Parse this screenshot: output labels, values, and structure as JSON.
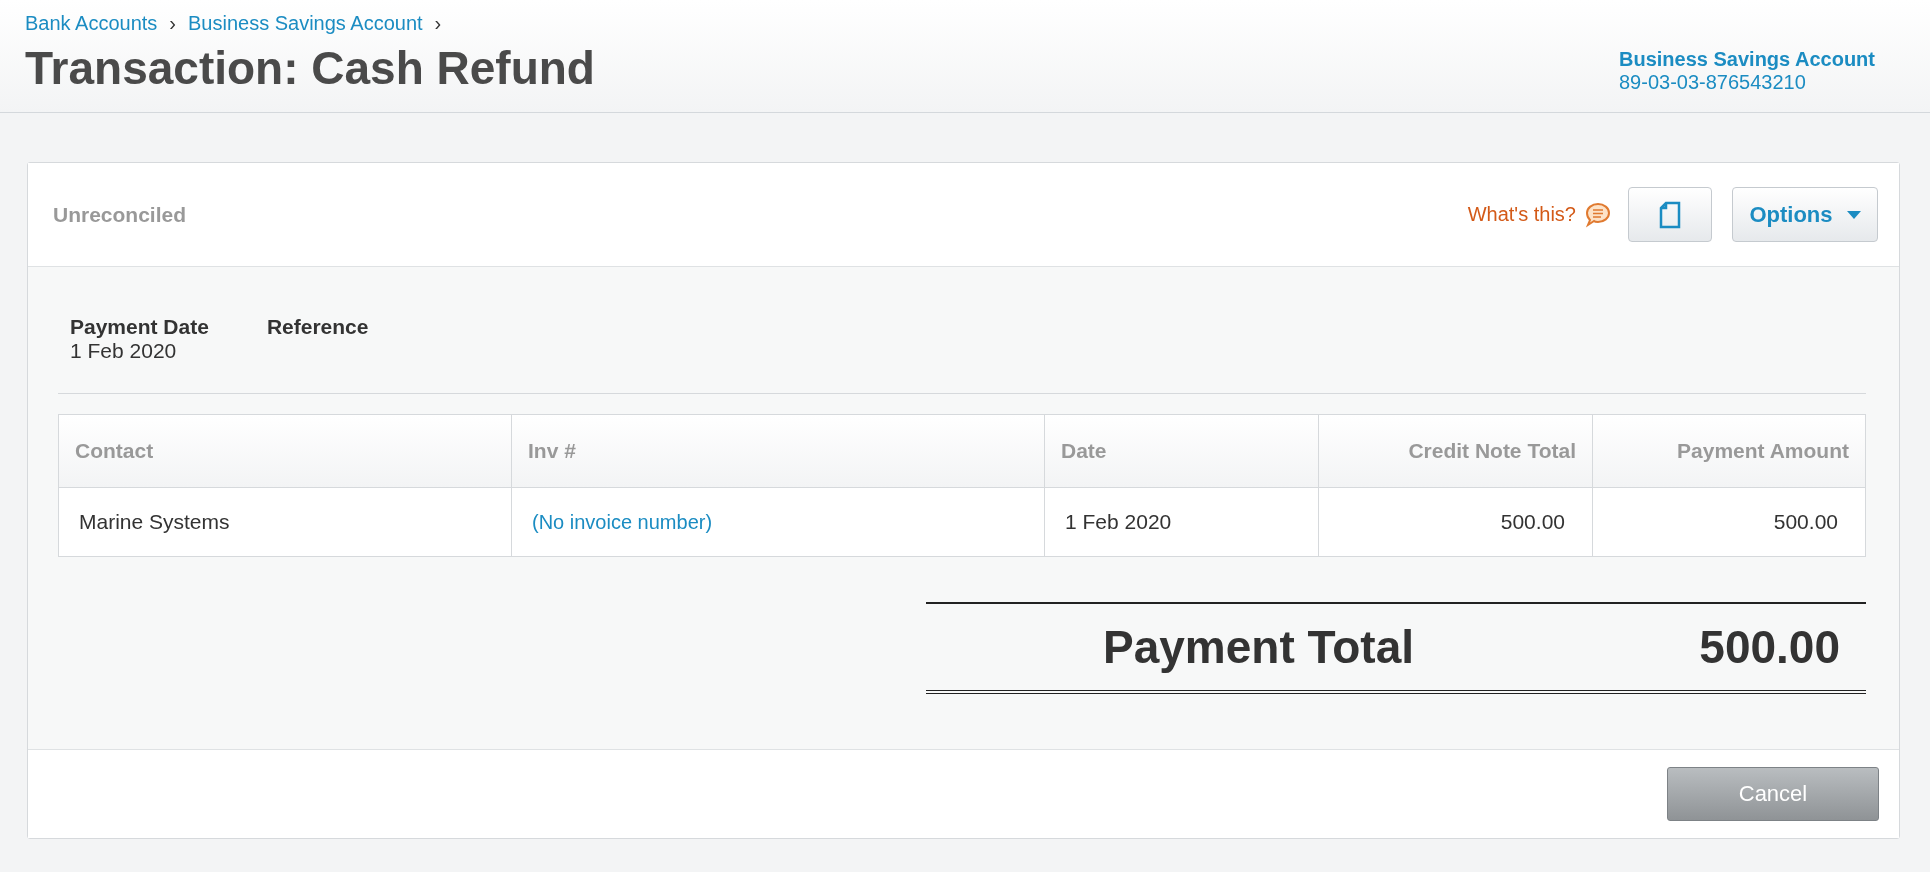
{
  "breadcrumbs": [
    {
      "label": "Bank Accounts",
      "separator": "›"
    },
    {
      "label": "Business Savings Account",
      "separator": "›"
    }
  ],
  "title": "Transaction: Cash Refund",
  "account": {
    "name": "Business Savings Account",
    "number": "89-03-03-876543210"
  },
  "status": "Unreconciled",
  "help_link": "What's this?",
  "options_button": "Options",
  "details": [
    {
      "label": "Payment Date",
      "value": "1 Feb 2020"
    },
    {
      "label": "Reference"
    }
  ],
  "table": {
    "columns": [
      {
        "label": "Contact",
        "kind": "text"
      },
      {
        "label": "Inv #",
        "kind": "text"
      },
      {
        "label": "Date",
        "kind": "text"
      },
      {
        "label": "Credit Note Total",
        "kind": "amount"
      },
      {
        "label": "Payment Amount",
        "kind": "amount"
      }
    ],
    "rows": [
      [
        {
          "text": "Marine Systems",
          "kind": "text"
        },
        {
          "text": "(No invoice number)",
          "kind": "link"
        },
        {
          "text": "1 Feb 2020",
          "kind": "text"
        },
        {
          "text": "500.00",
          "kind": "text"
        },
        {
          "text": "500.00",
          "kind": "text"
        }
      ]
    ]
  },
  "total": {
    "label": "Payment Total",
    "value": "500.00"
  },
  "cancel_button": "Cancel"
}
